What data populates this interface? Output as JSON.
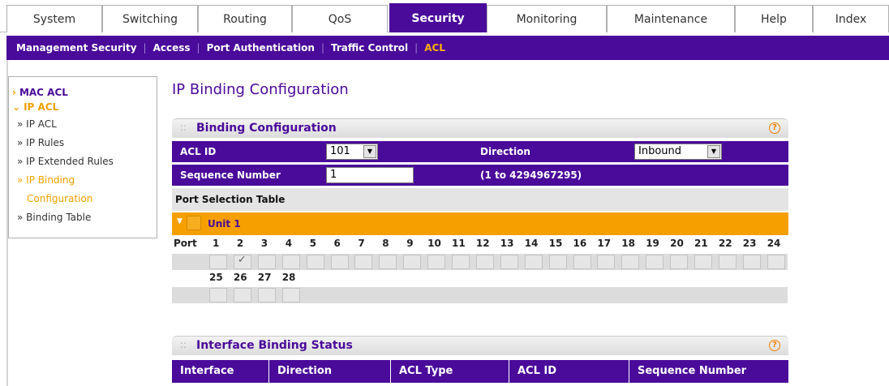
{
  "tabs": [
    {
      "label": "System"
    },
    {
      "label": "Switching"
    },
    {
      "label": "Routing"
    },
    {
      "label": "QoS"
    },
    {
      "label": "Security",
      "active": true
    },
    {
      "label": "Monitoring"
    },
    {
      "label": "Maintenance"
    },
    {
      "label": "Help"
    },
    {
      "label": "Index"
    }
  ],
  "subnav": {
    "items": [
      "Management Security",
      "Access",
      "Port Authentication",
      "Traffic Control",
      "ACL"
    ],
    "active": "ACL"
  },
  "sidebar": {
    "mac_acl": "MAC ACL",
    "ip_acl": "IP ACL",
    "items": [
      {
        "label": "» IP ACL"
      },
      {
        "label": "» IP Rules"
      },
      {
        "label": "» IP Extended Rules"
      },
      {
        "label": "» IP Binding"
      },
      {
        "label": "Configuration"
      },
      {
        "label": "» Binding Table"
      }
    ]
  },
  "page_title": "IP Binding Configuration",
  "binding_config": {
    "title": "Binding Configuration",
    "acl_id_label": "ACL ID",
    "acl_id_value": "101",
    "direction_label": "Direction",
    "direction_value": "Inbound",
    "sequence_label": "Sequence Number",
    "sequence_value": "1",
    "sequence_hint": "(1 to 4294967295)"
  },
  "port_selection": {
    "title": "Port Selection Table",
    "unit_label": "Unit 1",
    "port_header": "Port",
    "ports_row1": [
      "1",
      "2",
      "3",
      "4",
      "5",
      "6",
      "7",
      "8",
      "9",
      "10",
      "11",
      "12",
      "13",
      "14",
      "15",
      "16",
      "17",
      "18",
      "19",
      "20",
      "21",
      "22",
      "23",
      "24"
    ],
    "ports_row2": [
      "25",
      "26",
      "27",
      "28"
    ],
    "checked_port": "2",
    "check_mark": "✓"
  },
  "interface_binding": {
    "title": "Interface Binding Status",
    "columns": [
      "Interface",
      "Direction",
      "ACL Type",
      "ACL ID",
      "Sequence Number"
    ]
  },
  "help_glyph": "?",
  "colors": {
    "brand_purple": "#4a0a9a",
    "accent_orange": "#f5a000"
  }
}
